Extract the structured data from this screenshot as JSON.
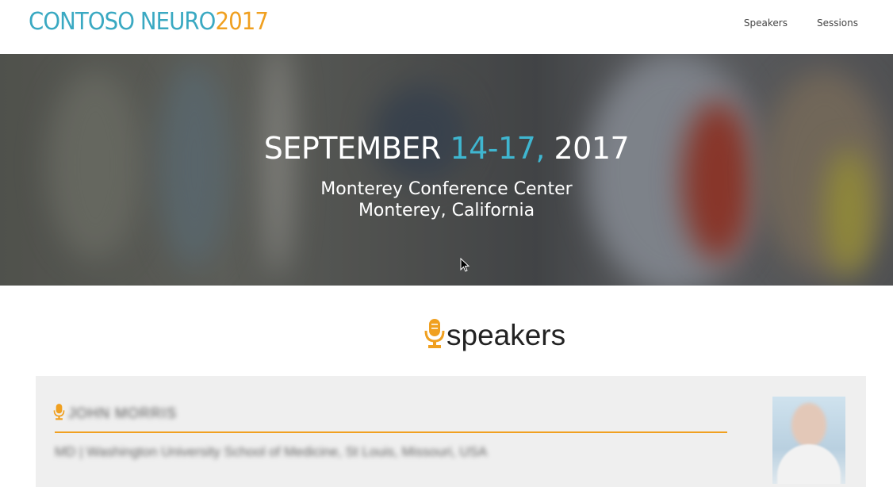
{
  "header": {
    "brand_main": "CONTOSO NEURO",
    "brand_year": "2017",
    "nav": [
      "Speakers",
      "Sessions"
    ]
  },
  "hero": {
    "date_start": "SEPTEMBER",
    "date_range": "14-17,",
    "date_year": "2017",
    "venue_line1": "Monterey Conference Center",
    "venue_line2": "Monterey, California"
  },
  "speakers_section": {
    "title": "speakers",
    "icon": "microphone-icon",
    "cards": [
      {
        "name": "JOHN MORRIS",
        "affiliation": "MD | Washington University School of Medicine, St Louis, Missouri, USA"
      }
    ]
  },
  "colors": {
    "brand_teal": "#3aa9c2",
    "accent_orange": "#f0a020",
    "date_blue": "#3fb6d0"
  }
}
